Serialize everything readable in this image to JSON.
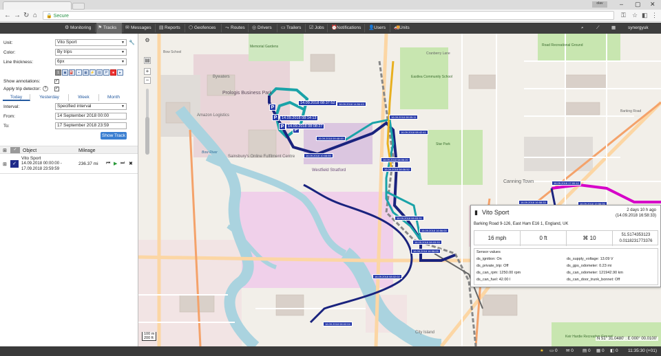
{
  "browser": {
    "profile_name": "olav",
    "secure_label": "Secure"
  },
  "nav": {
    "items": [
      {
        "label": "Monitoring",
        "icon": "gear-icon"
      },
      {
        "label": "Tracks",
        "icon": "flag-icon"
      },
      {
        "label": "Messages",
        "icon": "envelope-icon"
      },
      {
        "label": "Reports",
        "icon": "report-icon"
      },
      {
        "label": "Geofences",
        "icon": "geofence-icon"
      },
      {
        "label": "Routes",
        "icon": "route-icon"
      },
      {
        "label": "Drivers",
        "icon": "steering-wheel-icon"
      },
      {
        "label": "Trailers",
        "icon": "trailer-icon"
      },
      {
        "label": "Jobs",
        "icon": "jobs-icon"
      },
      {
        "label": "Notifications",
        "icon": "bell-icon"
      },
      {
        "label": "Users",
        "icon": "users-icon"
      },
      {
        "label": "Units",
        "icon": "truck-icon"
      }
    ],
    "user": "synergyuk"
  },
  "form": {
    "unit_label": "Unit:",
    "unit_value": "Vito Sport",
    "color_label": "Color:",
    "color_value": "By trips",
    "thickness_label": "Line thickness:",
    "thickness_value": "6px",
    "annotations_label": "Show annotations:",
    "trip_detector_label": "Apply trip detector:",
    "interval_label": "Interval:",
    "interval_value": "Specified interval",
    "from_label": "From:",
    "from_value": "14 September 2018 00:00",
    "to_label": "To:",
    "to_value": "17 September 2018 23:59",
    "show_track": "Show Track"
  },
  "quick_ranges": [
    "Today",
    "Yesterday",
    "Week",
    "Month"
  ],
  "list": {
    "col_object": "Object",
    "col_mileage": "Mileage",
    "row_name": "Vito Sport",
    "row_period1": "14.09.2018 00:00:00 -",
    "row_period2": "17.09.2018 23:59:59",
    "row_mileage": "236.37 mi"
  },
  "map": {
    "scale_m": "100 m",
    "scale_ft": "200 ft",
    "coords": "N 51° 31.0480' : E 000° 00.0100'",
    "labels": {
      "memorial": "Memorial Gardens",
      "prologis": "Prologis Business Park",
      "amazon": "Amazon Logistics",
      "sainsbury": "Sainsbury's Online Fulfilment Centre",
      "westfield": "Westfield Stratford",
      "eastlea": "Eastlea Community School",
      "starpark": "Star Park",
      "roadrec": "Road Recreational Ground",
      "bywaters": "Bywaters",
      "bowriver": "Bow River",
      "cityisland": "City Island",
      "canning": "Canning Town",
      "keirhardie": "Keir Hardie Recreation Ground",
      "cranberry": "Cranberry Lane",
      "barking": "Barking Road",
      "bowschool": "Bow School"
    },
    "pins": [
      "14.09.2018 08:37:52",
      "14.09.2018 08:14:13",
      "14.09.2018 08:08:27",
      "16.09.2018 17:00:12",
      "16.09.2018 14:54:43",
      "16.09.2018 09:48:49",
      "16.09.2018 10:08:55",
      "16.09.2018 08:05:11",
      "16.09.2018 08:42:41",
      "16.09.2018 08:06:20",
      "16.09.2018 08:06:52",
      "16.09.2018 08:03:31",
      "16.09.2018 16:56:00",
      "16.09.2018 08:03:33",
      "16.09.2018 16:58:05",
      "16.09.2018 08:02:02",
      "16.09.2018 08:02:04",
      "16.09.2018 16:58:33",
      "16.09.2018 19:56:06"
    ]
  },
  "popup": {
    "title": "Vito Sport",
    "ago1": "2 days 10 h ago",
    "ago2": "(14.09.2018 16:58:33)",
    "address": "Barking Road 9-126, East Ham E16 1, England, UK",
    "speed": "16 mph",
    "altitude": "0 ft",
    "sats": "10",
    "lat": "51.5174353123",
    "lon": "0.0118231773376",
    "sensor_header": "Sensor values",
    "sensors_left": [
      "ds_ignition: On",
      "ds_private_trip: Off",
      "ds_can_rpm: 1250.00 rpm",
      "ds_can_fuel: 42.00 l"
    ],
    "sensors_right": [
      "ds_supply_voltage: 13.09 V",
      "ds_gps_odometer: 0.23 mi",
      "ds_can_odometer: 121942.90 km",
      "ds_can_door_trunk_bonnet: Off"
    ]
  },
  "status": {
    "counts": [
      "0",
      "0",
      "0",
      "0",
      "0"
    ],
    "time": "11:35:30 (+01)"
  },
  "colors": {
    "nav_bg": "#3e3e3e",
    "accent": "#3b7fd1",
    "track_dark": "#1a237e",
    "track_teal": "#1aa3a8",
    "track_magenta": "#d600c8",
    "water": "#aad3df",
    "park": "#c8e6b0"
  }
}
